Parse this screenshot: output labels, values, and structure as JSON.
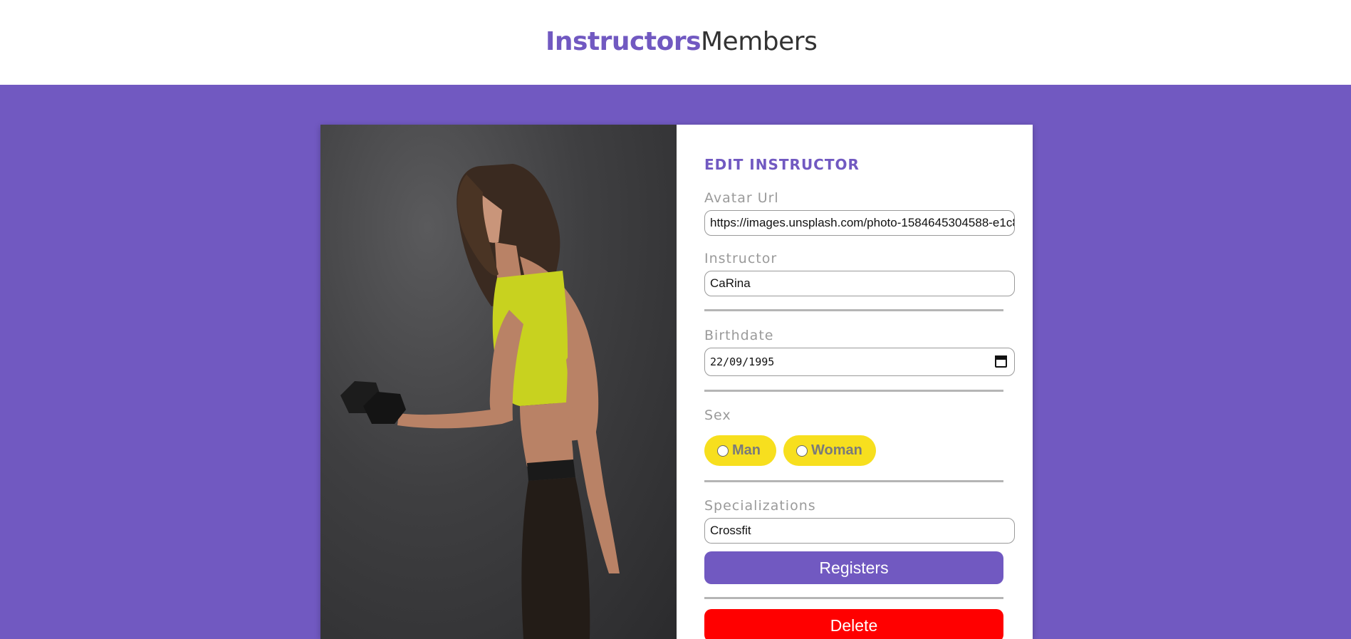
{
  "nav": {
    "instructors": "Instructors",
    "members": "Members"
  },
  "form": {
    "title": "EDIT INSTRUCTOR",
    "avatar_label": "Avatar Url",
    "avatar_value": "https://images.unsplash.com/photo-1584645304588-e1c8",
    "instructor_label": "Instructor",
    "instructor_value": "CaRina",
    "birthdate_label": "Birthdate",
    "birthdate_value": "22/09/1995",
    "sex_label": "Sex",
    "sex_options": [
      "Man",
      "Woman"
    ],
    "specializations_label": "Specializations",
    "specializations_value": "Crossfit",
    "register_button": "Registers",
    "delete_button": "Delete"
  },
  "colors": {
    "brand": "#7159c1",
    "accent_yellow": "#f7df1e",
    "danger": "#ff0000"
  }
}
